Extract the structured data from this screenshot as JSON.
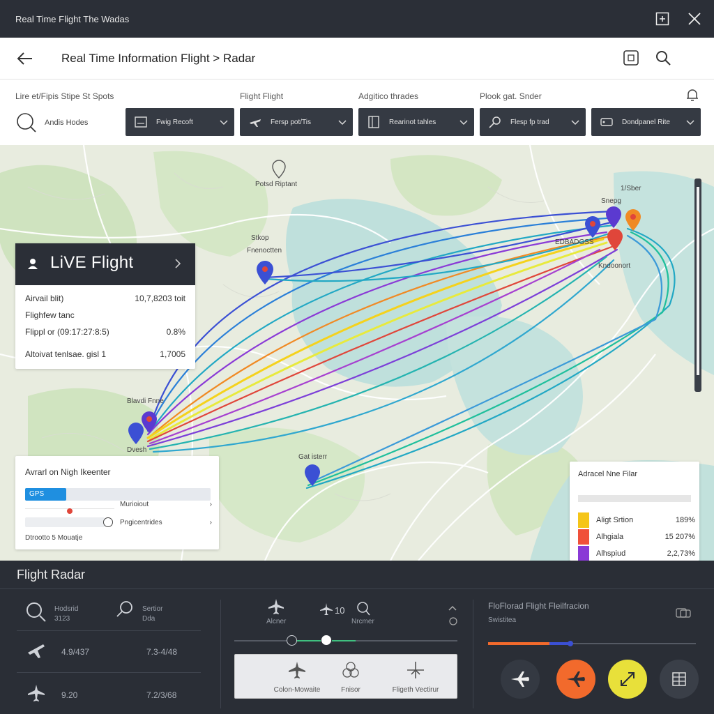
{
  "window": {
    "title": "Real Time Flight The Wadas"
  },
  "header": {
    "title": "Real Time Information Flight > Radar"
  },
  "filters": {
    "labels": [
      "Lire et/Fipis Stipe St Spots",
      "Flight Flight",
      "Adgitico thrades",
      "Plook gat. Snder"
    ],
    "search_label": "Andis Hodes",
    "dropdowns": [
      "Fwig Recoft",
      "Fersp pot/Tis",
      "Rearinot tahles",
      "Flesp fp trad",
      "Dondpanel Rite"
    ]
  },
  "map": {
    "labels": {
      "pin_top": "Potsd Riptant",
      "city_ne": "1/Sber",
      "city_ne2": "Snepg",
      "city_ne3": "EDBADGSS",
      "city_ne4": "Kndoonort",
      "city_mid": "Stkop",
      "city_mid2": "Fnenoctten",
      "city_sw": "Blavdi Fnne",
      "city_sw2": "Dvesh",
      "city_s": "Gat isterr"
    }
  },
  "live_card": {
    "title": "LiVE Flight",
    "rows": [
      {
        "label": "Airvail blit)",
        "value": "10,7,8203 toit"
      },
      {
        "label": "Flighfew tanc",
        "value": ""
      },
      {
        "label": "Flippl or (09:17:27:8:5)",
        "value": "0.8%"
      },
      {
        "label": "Altoivat tenlsae. gisl 1",
        "value": "1,7005"
      }
    ]
  },
  "radar_card": {
    "title": "Avrarl on Nigh Ikeenter",
    "gps_label": "GPS",
    "gps_progress": 0.22,
    "option1": "Murioiout",
    "option2": "Pngicentrides",
    "footer": "Dtrootto 5 Mouatje"
  },
  "filter_card": {
    "title": "Adracel Nne Filar",
    "items": [
      {
        "label": "Aligt Srtion",
        "value": "189%",
        "color": "#f5c518"
      },
      {
        "label": "Alhgiala",
        "value": "15 207%",
        "color": "#f0503a"
      },
      {
        "label": "Alhspiud",
        "value": "2,2,73%",
        "color": "#8a3ad6"
      }
    ]
  },
  "bottom": {
    "title": "Flight Radar",
    "col1": {
      "search1": "Hodsrid",
      "search1_sub": "3123",
      "search2": "Sertior",
      "search2_sub": "Dda",
      "row1": {
        "a": "4.9/437",
        "b": "7.3-4/48"
      },
      "row2": {
        "a": "9.20",
        "b": "7.2/3/68"
      }
    },
    "col2": {
      "icon1_label": "Alcner",
      "count": "10",
      "icon3_label": "Nrcmer",
      "modes": [
        "Colon-Mowaite",
        "Fnisor",
        "Fligeth Vectirur"
      ]
    },
    "col3": {
      "title": "FloFlorad Flight Fleilfracion",
      "sub": "Swistitea"
    },
    "colors": {
      "orange": "#f26a2c",
      "yellow": "#e8e03a",
      "dark": "#3a3f48"
    }
  }
}
